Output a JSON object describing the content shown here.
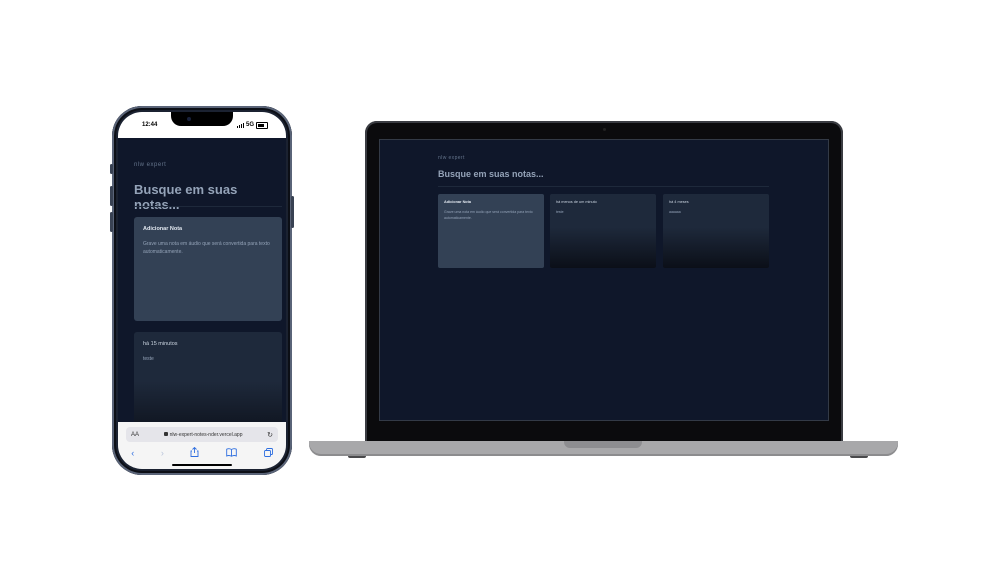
{
  "phone": {
    "status_time": "12:44",
    "status_network": "5G",
    "app": {
      "logo": "nlw expert",
      "search_placeholder": "Busque em suas notas...",
      "add_card": {
        "title": "Adicionar Nota",
        "text": "Grave uma nota em áudio que será convertida para texto automaticamente."
      },
      "note_card": {
        "date": "há 15 minutos",
        "content": "teste"
      }
    },
    "safari": {
      "aa_label": "AA",
      "url": "nlw-expert-notes-nder.vercel.app"
    }
  },
  "laptop": {
    "app": {
      "logo": "nlw expert",
      "search_placeholder": "Busque em suas notas...",
      "add_card": {
        "title": "Adicionar Nota",
        "text": "Grave uma nota em áudio que será convertida para texto automaticamente."
      },
      "notes": [
        {
          "date": "há menos de um minuto",
          "content": "teste"
        },
        {
          "date": "há 4 meses",
          "content": "aaaaaa"
        }
      ]
    }
  },
  "colors": {
    "app_background": "#0f172a",
    "card_add": "#334155",
    "card_note": "#1e293b",
    "text_muted": "#94a3b8",
    "safari_accent": "#2f6fe0"
  },
  "icons": [
    "lock-icon",
    "reload-icon",
    "back-icon",
    "forward-icon",
    "share-icon",
    "bookmarks-icon",
    "tabs-icon"
  ]
}
